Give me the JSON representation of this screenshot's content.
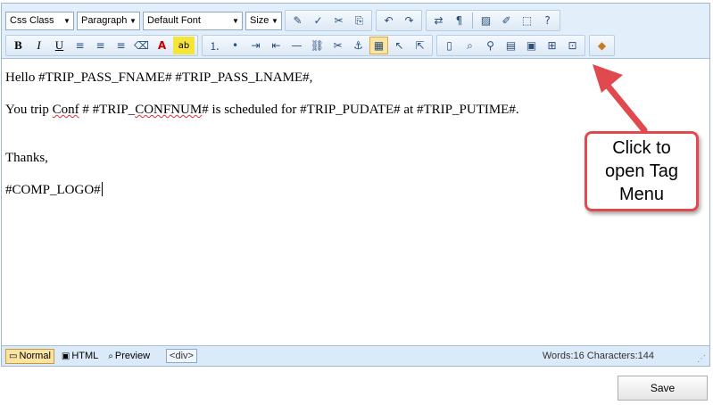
{
  "toolbar": {
    "dropdowns": [
      {
        "name": "css-class-dropdown",
        "label": "Css Class"
      },
      {
        "name": "paragraph-dropdown",
        "label": "Paragraph"
      },
      {
        "name": "font-dropdown",
        "label": "Default Font"
      },
      {
        "name": "size-dropdown",
        "label": "Size"
      }
    ],
    "icons": {
      "bold": "B",
      "italic": "I",
      "underline": "U",
      "align_left": "≡",
      "align_center": "≡",
      "align_right": "≡",
      "eraser": "⌫",
      "font_color": "A",
      "highlight": "ab",
      "ordered_list": "⒈",
      "unordered_list": "•",
      "indent": "⇥",
      "outdent": "⇤",
      "hr": "—",
      "link": "⛓",
      "unlink": "✂",
      "anchor": "⚓",
      "table_grid": "▦",
      "select": "↖",
      "pointer": "⇱",
      "new_doc": "▯",
      "preview": "⌕",
      "find": "⚲",
      "template": "▤",
      "form": "▣",
      "properties": "⊞",
      "cell": "⊡",
      "tag_menu": "◆",
      "format_painter": "✎",
      "spell": "✓",
      "cut": "✂",
      "copy": "⎘",
      "undo": "↶",
      "redo": "↷",
      "spell_rtl": "⇄",
      "paragraph_mark": "¶",
      "image": "▨",
      "media": "✐",
      "pdf": "⬚",
      "help": "?"
    }
  },
  "content": {
    "line1": "Hello #TRIP_PASS_FNAME# #TRIP_PASS_LNAME#,",
    "line2_prefix": "You trip  ",
    "line2_conf": "Conf",
    "line2_mid": " # #TRIP_",
    "line2_confnum": "CONFNUM",
    "line2_rest": "# is scheduled for #TRIP_PUDATE# at #TRIP_PUTIME#.",
    "line3": "Thanks,",
    "line4": "#COMP_LOGO#"
  },
  "statusbar": {
    "mode_normal": "Normal",
    "mode_html": "HTML",
    "mode_preview": "Preview",
    "tag_path": "<div>",
    "stats": "Words:16 Characters:144"
  },
  "save_label": "Save",
  "callout": {
    "line1": "Click to",
    "line2": "open Tag",
    "line3": "Menu",
    "color": "#e04a4f"
  }
}
